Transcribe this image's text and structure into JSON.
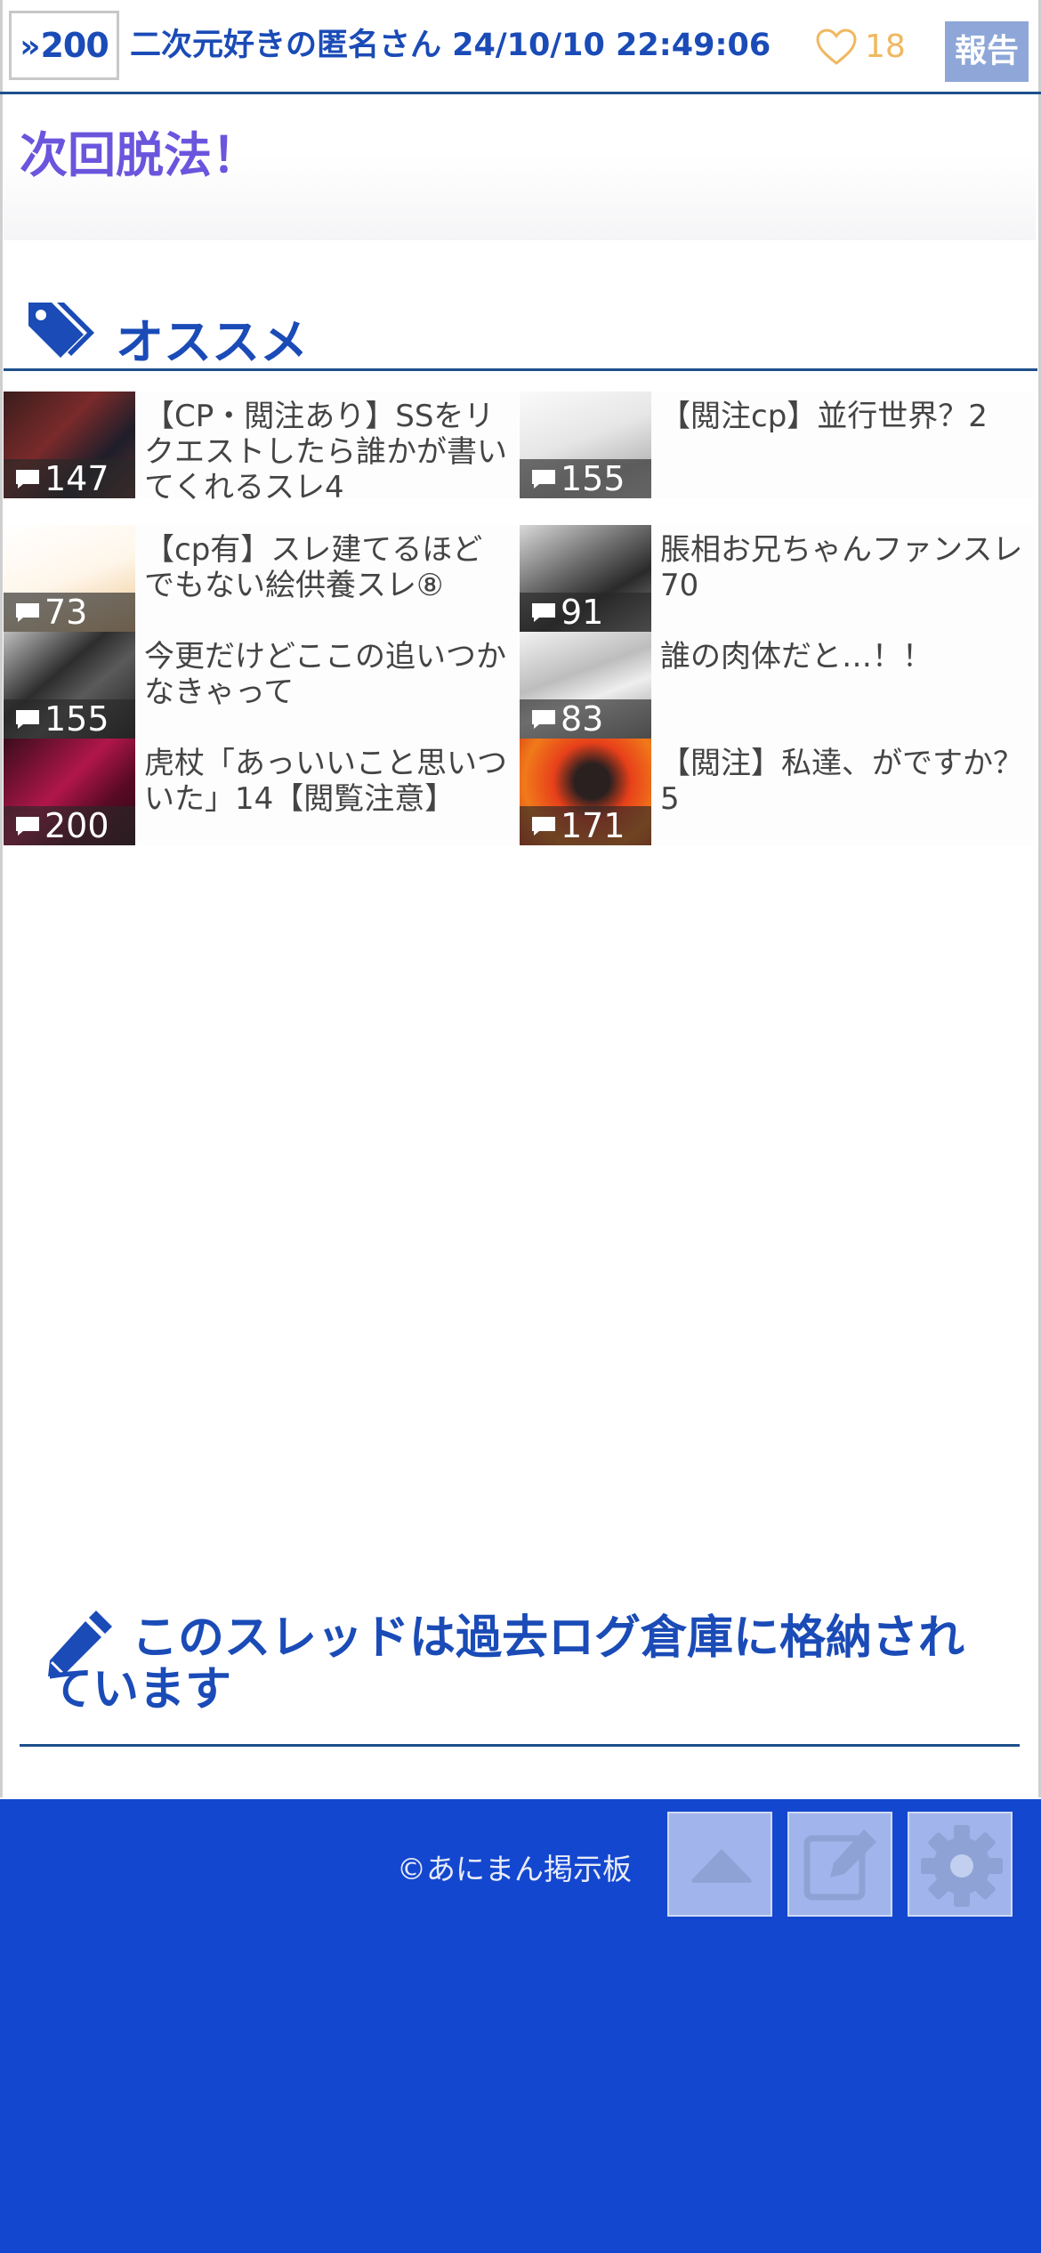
{
  "post": {
    "number": "200",
    "poster_line": "二次元好きの匿名さん 24/10/10 22:49:06",
    "likes": "18",
    "report_label": "報告",
    "body": "次回脱法！"
  },
  "recommend": {
    "title": "オススメ",
    "items": [
      {
        "title": "【CP・閲注あり】SSをリクエストしたら誰かが書いてくれるスレ4",
        "count": "147"
      },
      {
        "title": "【閲注cp】並行世界？2",
        "count": "155"
      },
      {
        "title": "【cp有】スレ建てるほどでもない絵供養スレ⑧",
        "count": "73"
      },
      {
        "title": "脹相お兄ちゃんファンスレ70",
        "count": "91"
      },
      {
        "title": "今更だけどここの追いつかなきゃって",
        "count": "155"
      },
      {
        "title": "誰の肉体だと…！！",
        "count": "83"
      },
      {
        "title": "虎杖「あっいいこと思いついた」14【閲覧注意】",
        "count": "200"
      },
      {
        "title": "【閲注】私達、がですか？5",
        "count": "171"
      }
    ]
  },
  "archive_notice": "このスレッドは過去ログ倉庫に格納されています",
  "footer": {
    "copyright": "©あにまん掲示板"
  },
  "colors": {
    "accent": "#1a4bb7",
    "body_text": "#6a55dd",
    "footer_bg": "#1447cf",
    "likes": "#f0b860",
    "report_bg": "#8ea7d8"
  }
}
